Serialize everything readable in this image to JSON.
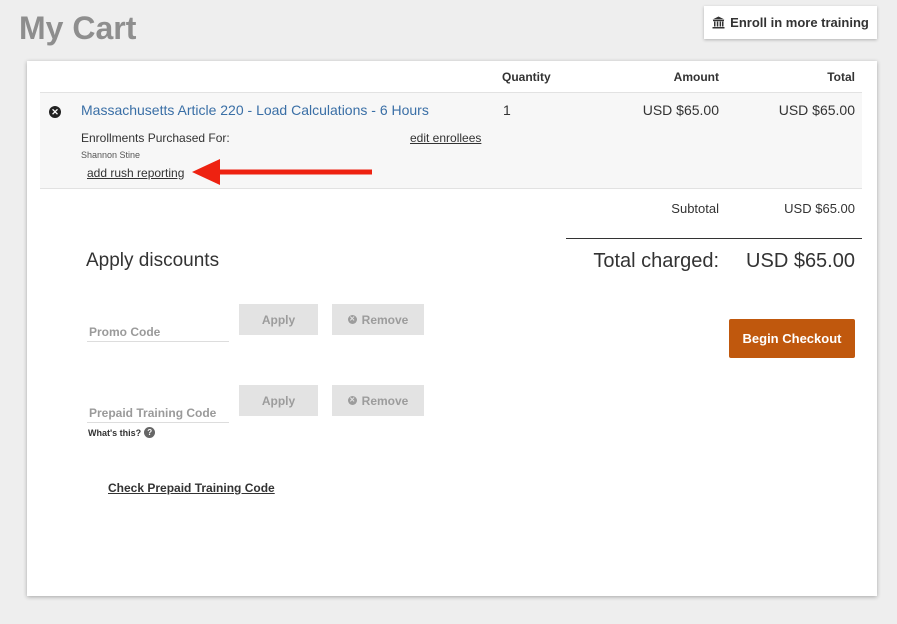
{
  "page": {
    "title": "My Cart"
  },
  "header": {
    "enroll_more_label": "Enroll in more training",
    "enroll_icon": "bank-icon"
  },
  "table": {
    "headers": {
      "quantity": "Quantity",
      "amount": "Amount",
      "total": "Total"
    },
    "items": [
      {
        "course": "Massachusetts Article 220 - Load Calculations - 6 Hours",
        "quantity": "1",
        "amount": "USD $65.00",
        "total": "USD $65.00",
        "enrollments_label": "Enrollments Purchased For:",
        "edit_enrollees": "edit enrollees",
        "enrollee": "Shannon Stine",
        "rush_reporting": "add rush reporting"
      }
    ]
  },
  "summary": {
    "subtotal_label": "Subtotal",
    "subtotal_value": "USD $65.00",
    "total_charged_label": "Total charged:",
    "total_charged_value": "USD $65.00"
  },
  "discounts": {
    "heading": "Apply discounts",
    "promo_placeholder": "Promo Code",
    "prepaid_placeholder": "Prepaid Training Code",
    "apply_label": "Apply",
    "remove_label": "Remove",
    "whats_this": "What's this?",
    "check_prepaid": "Check Prepaid Training Code"
  },
  "checkout": {
    "label": "Begin Checkout",
    "color": "#c0580d"
  },
  "annotation": {
    "arrow_color": "#ee2211"
  }
}
